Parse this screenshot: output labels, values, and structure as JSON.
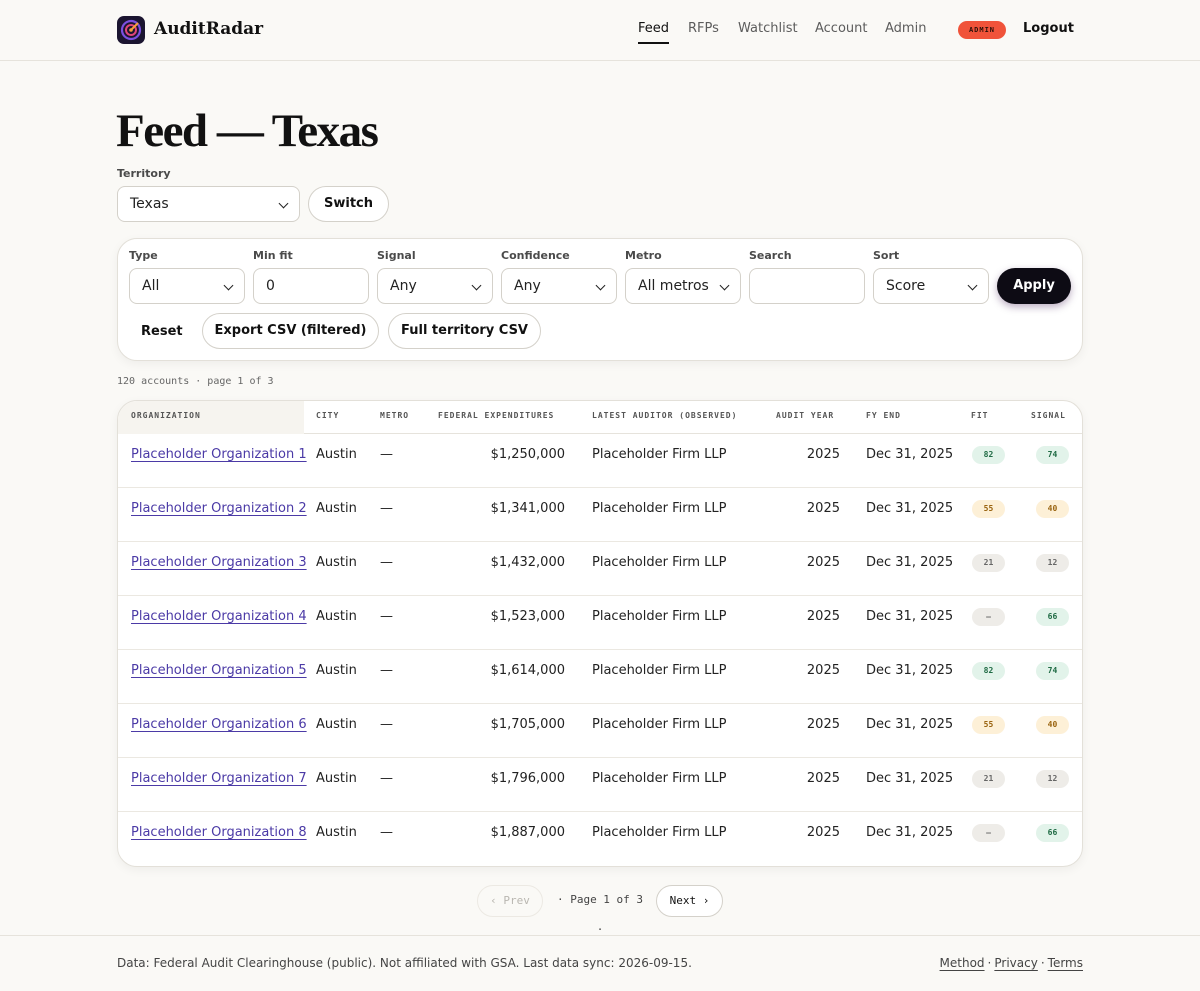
{
  "header": {
    "brand": "AuditRadar",
    "nav": [
      {
        "label": "Feed",
        "active": true
      },
      {
        "label": "RFPs"
      },
      {
        "label": "Watchlist"
      },
      {
        "label": "Account"
      },
      {
        "label": "Admin"
      }
    ],
    "role_badge": "ADMIN",
    "logout_label": "Logout"
  },
  "page": {
    "title": "Feed — Texas"
  },
  "territory": {
    "label": "Territory",
    "value": "Texas",
    "switch_label": "Switch"
  },
  "filters": {
    "type": {
      "label": "Type",
      "value": "All"
    },
    "min_fit": {
      "label": "Min fit",
      "value": "0"
    },
    "signal": {
      "label": "Signal",
      "value": "Any"
    },
    "confidence": {
      "label": "Confidence",
      "value": "Any"
    },
    "metro": {
      "label": "Metro",
      "value": "All metros"
    },
    "search": {
      "label": "Search",
      "value": ""
    },
    "sort": {
      "label": "Sort",
      "value": "Score"
    },
    "apply_label": "Apply",
    "reset_label": "Reset",
    "export_filtered_label": "Export CSV (filtered)",
    "export_full_label": "Full territory CSV"
  },
  "results": {
    "summary": "120 accounts · page 1 of 3"
  },
  "table": {
    "columns": [
      "ORGANIZATION",
      "CITY",
      "METRO",
      "FEDERAL EXPENDITURES",
      "LATEST AUDITOR (OBSERVED)",
      "AUDIT YEAR",
      "FY END",
      "FIT",
      "SIGNAL"
    ],
    "rows": [
      {
        "org": "Placeholder Organization 1",
        "city": "Austin",
        "metro": "—",
        "expenditures": "$1,250,000",
        "auditor": "Placeholder Firm LLP",
        "year": "2025",
        "fy_end": "Dec 31, 2025",
        "fit": "82",
        "fit_level": "green",
        "signal": "74",
        "signal_level": "green"
      },
      {
        "org": "Placeholder Organization 2",
        "city": "Austin",
        "metro": "—",
        "expenditures": "$1,341,000",
        "auditor": "Placeholder Firm LLP",
        "year": "2025",
        "fy_end": "Dec 31, 2025",
        "fit": "55",
        "fit_level": "amber",
        "signal": "40",
        "signal_level": "amber"
      },
      {
        "org": "Placeholder Organization 3",
        "city": "Austin",
        "metro": "—",
        "expenditures": "$1,432,000",
        "auditor": "Placeholder Firm LLP",
        "year": "2025",
        "fy_end": "Dec 31, 2025",
        "fit": "21",
        "fit_level": "gray",
        "signal": "12",
        "signal_level": "gray"
      },
      {
        "org": "Placeholder Organization 4",
        "city": "Austin",
        "metro": "—",
        "expenditures": "$1,523,000",
        "auditor": "Placeholder Firm LLP",
        "year": "2025",
        "fy_end": "Dec 31, 2025",
        "fit": "—",
        "fit_level": "gray",
        "signal": "66",
        "signal_level": "green"
      },
      {
        "org": "Placeholder Organization 5",
        "city": "Austin",
        "metro": "—",
        "expenditures": "$1,614,000",
        "auditor": "Placeholder Firm LLP",
        "year": "2025",
        "fy_end": "Dec 31, 2025",
        "fit": "82",
        "fit_level": "green",
        "signal": "74",
        "signal_level": "green"
      },
      {
        "org": "Placeholder Organization 6",
        "city": "Austin",
        "metro": "—",
        "expenditures": "$1,705,000",
        "auditor": "Placeholder Firm LLP",
        "year": "2025",
        "fy_end": "Dec 31, 2025",
        "fit": "55",
        "fit_level": "amber",
        "signal": "40",
        "signal_level": "amber"
      },
      {
        "org": "Placeholder Organization 7",
        "city": "Austin",
        "metro": "—",
        "expenditures": "$1,796,000",
        "auditor": "Placeholder Firm LLP",
        "year": "2025",
        "fy_end": "Dec 31, 2025",
        "fit": "21",
        "fit_level": "gray",
        "signal": "12",
        "signal_level": "gray"
      },
      {
        "org": "Placeholder Organization 8",
        "city": "Austin",
        "metro": "—",
        "expenditures": "$1,887,000",
        "auditor": "Placeholder Firm LLP",
        "year": "2025",
        "fy_end": "Dec 31, 2025",
        "fit": "—",
        "fit_level": "gray",
        "signal": "66",
        "signal_level": "green"
      }
    ]
  },
  "pagination": {
    "prev_label": "‹ Prev",
    "info": "· Page 1 of 3 ·",
    "next_label": "Next ›"
  },
  "footer": {
    "text": "Data: Federal Audit Clearinghouse (public). Not affiliated with GSA. Last data sync: 2026-09-15.",
    "links": [
      "Method",
      "Privacy",
      "Terms"
    ]
  },
  "colors": {
    "accent": "#4b3aa6",
    "admin_badge": "#f0533a",
    "primary_button": "#0d0b14"
  },
  "icons": {
    "logo": "radar-logo-icon",
    "dropdown": "chevron-down-icon"
  }
}
